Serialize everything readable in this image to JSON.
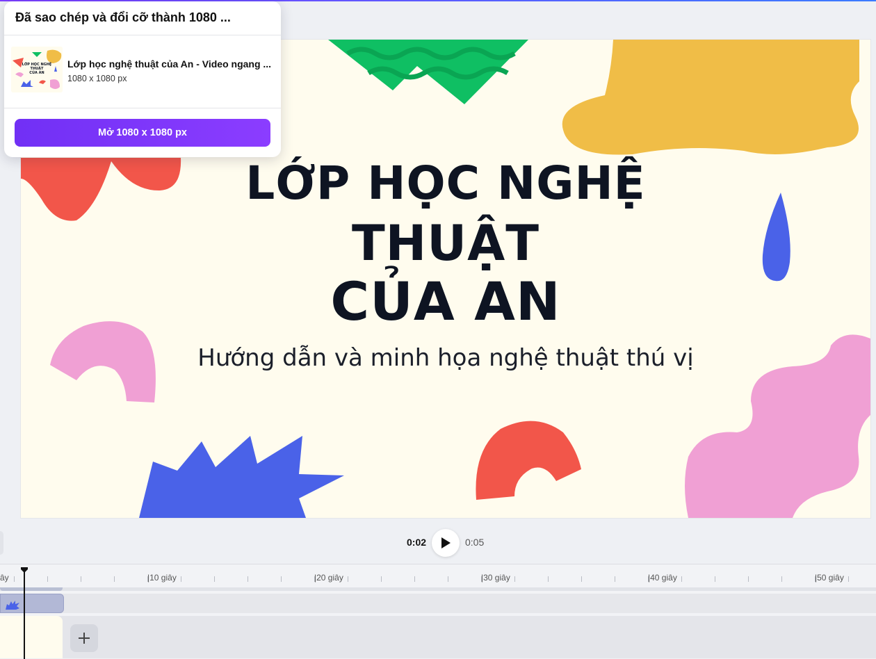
{
  "popup": {
    "title": "Đã sao chép và đổi cỡ thành 1080 ...",
    "item_name": "Lớp học nghệ thuật của An - Video ngang ...",
    "item_size": "1080 x 1080 px",
    "open_button": "Mở 1080 x 1080 px",
    "thumb_text": [
      "LỚP HỌC NGHỆ",
      "THUẬT",
      "CỦA AN"
    ]
  },
  "canvas": {
    "title_lines": [
      "LỚP HỌC NGHỆ",
      "THUẬT",
      "CỦA AN"
    ],
    "subtitle": "Hướng dẫn và minh họa nghệ thuật thú vị"
  },
  "playback": {
    "current_time": "0:02",
    "total_time": "0:05"
  },
  "timeline": {
    "labels": [
      "ây",
      "10 giây",
      "20 giây",
      "30 giây",
      "40 giây",
      "50 giây"
    ]
  },
  "colors": {
    "accent": "#8b3dff",
    "canvas_bg": "#fffcee",
    "green": "#0fbf63",
    "yellow": "#f0bd47",
    "red": "#f2564a",
    "blue": "#4a62e8",
    "pink": "#f0a0d4"
  },
  "icons": {
    "play": "play-icon",
    "add": "plus-icon",
    "playhead": "playhead-icon"
  }
}
